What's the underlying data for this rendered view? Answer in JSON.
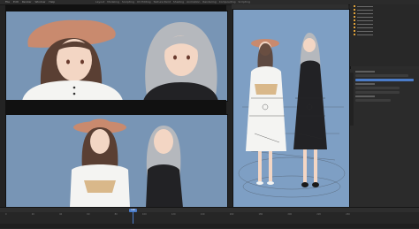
{
  "menu": [
    "File",
    "Edit",
    "Render",
    "Window",
    "Help"
  ],
  "workspace_tabs": [
    "Layout",
    "Modeling",
    "Sculpting",
    "UV Editing",
    "Texture Paint",
    "Shading",
    "Animation",
    "Rendering",
    "Compositing",
    "Scripting"
  ],
  "timeline": {
    "ticks": [
      "0",
      "20",
      "40",
      "60",
      "80",
      "100",
      "120",
      "140",
      "160",
      "180",
      "200",
      "220",
      "240"
    ],
    "current_frame": "100"
  },
  "colors": {
    "viewport_bg": "#7895b5",
    "hat": "#c98a6e",
    "hair_gray": "#b5b8bd",
    "hair_brown": "#5a3f33",
    "dress_white": "#f4f4f2",
    "dress_black": "#222225",
    "skin": "#f3d6c4",
    "accent_blue": "#4b7cc9"
  }
}
